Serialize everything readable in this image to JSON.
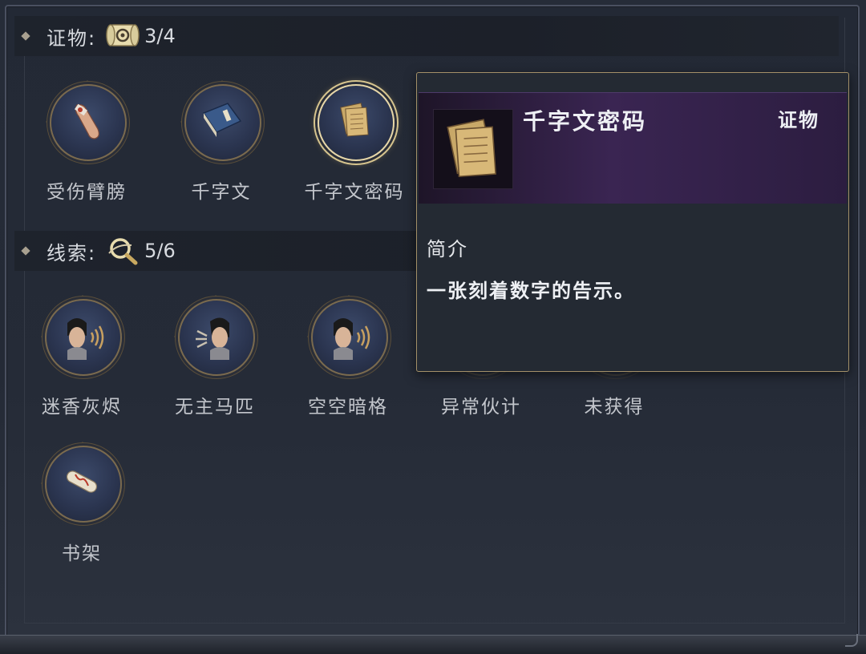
{
  "evidence": {
    "title": "证物:",
    "count": "3/4",
    "icon": "scroll-icon",
    "items": [
      {
        "label": "受伤臂膀",
        "icon": "injured-arm-icon"
      },
      {
        "label": "千字文",
        "icon": "book-icon"
      },
      {
        "label": "千字文密码",
        "icon": "papers-icon",
        "selected": true
      }
    ]
  },
  "clues": {
    "title": "线索:",
    "count": "5/6",
    "icon": "magnifier-icon",
    "items": [
      {
        "label": "迷香灰烬",
        "icon": "character-listening-icon"
      },
      {
        "label": "无主马匹",
        "icon": "character-speaking-icon"
      },
      {
        "label": "空空暗格",
        "icon": "character-listening-icon"
      },
      {
        "label": "异常伙计",
        "icon": "character-speaking-icon"
      },
      {
        "label": "未获得",
        "icon": "question-mark-icon",
        "locked": true
      },
      {
        "label": "书架",
        "icon": "scroll-roll-icon"
      }
    ]
  },
  "tooltip": {
    "name": "千字文密码",
    "type": "证物",
    "section": "简介",
    "description": "一张刻着数字的告示。"
  },
  "colors": {
    "accent_gold": "#d6c48e",
    "tooltip_purple": "#3a2552",
    "panel_bg": "#252b37"
  }
}
